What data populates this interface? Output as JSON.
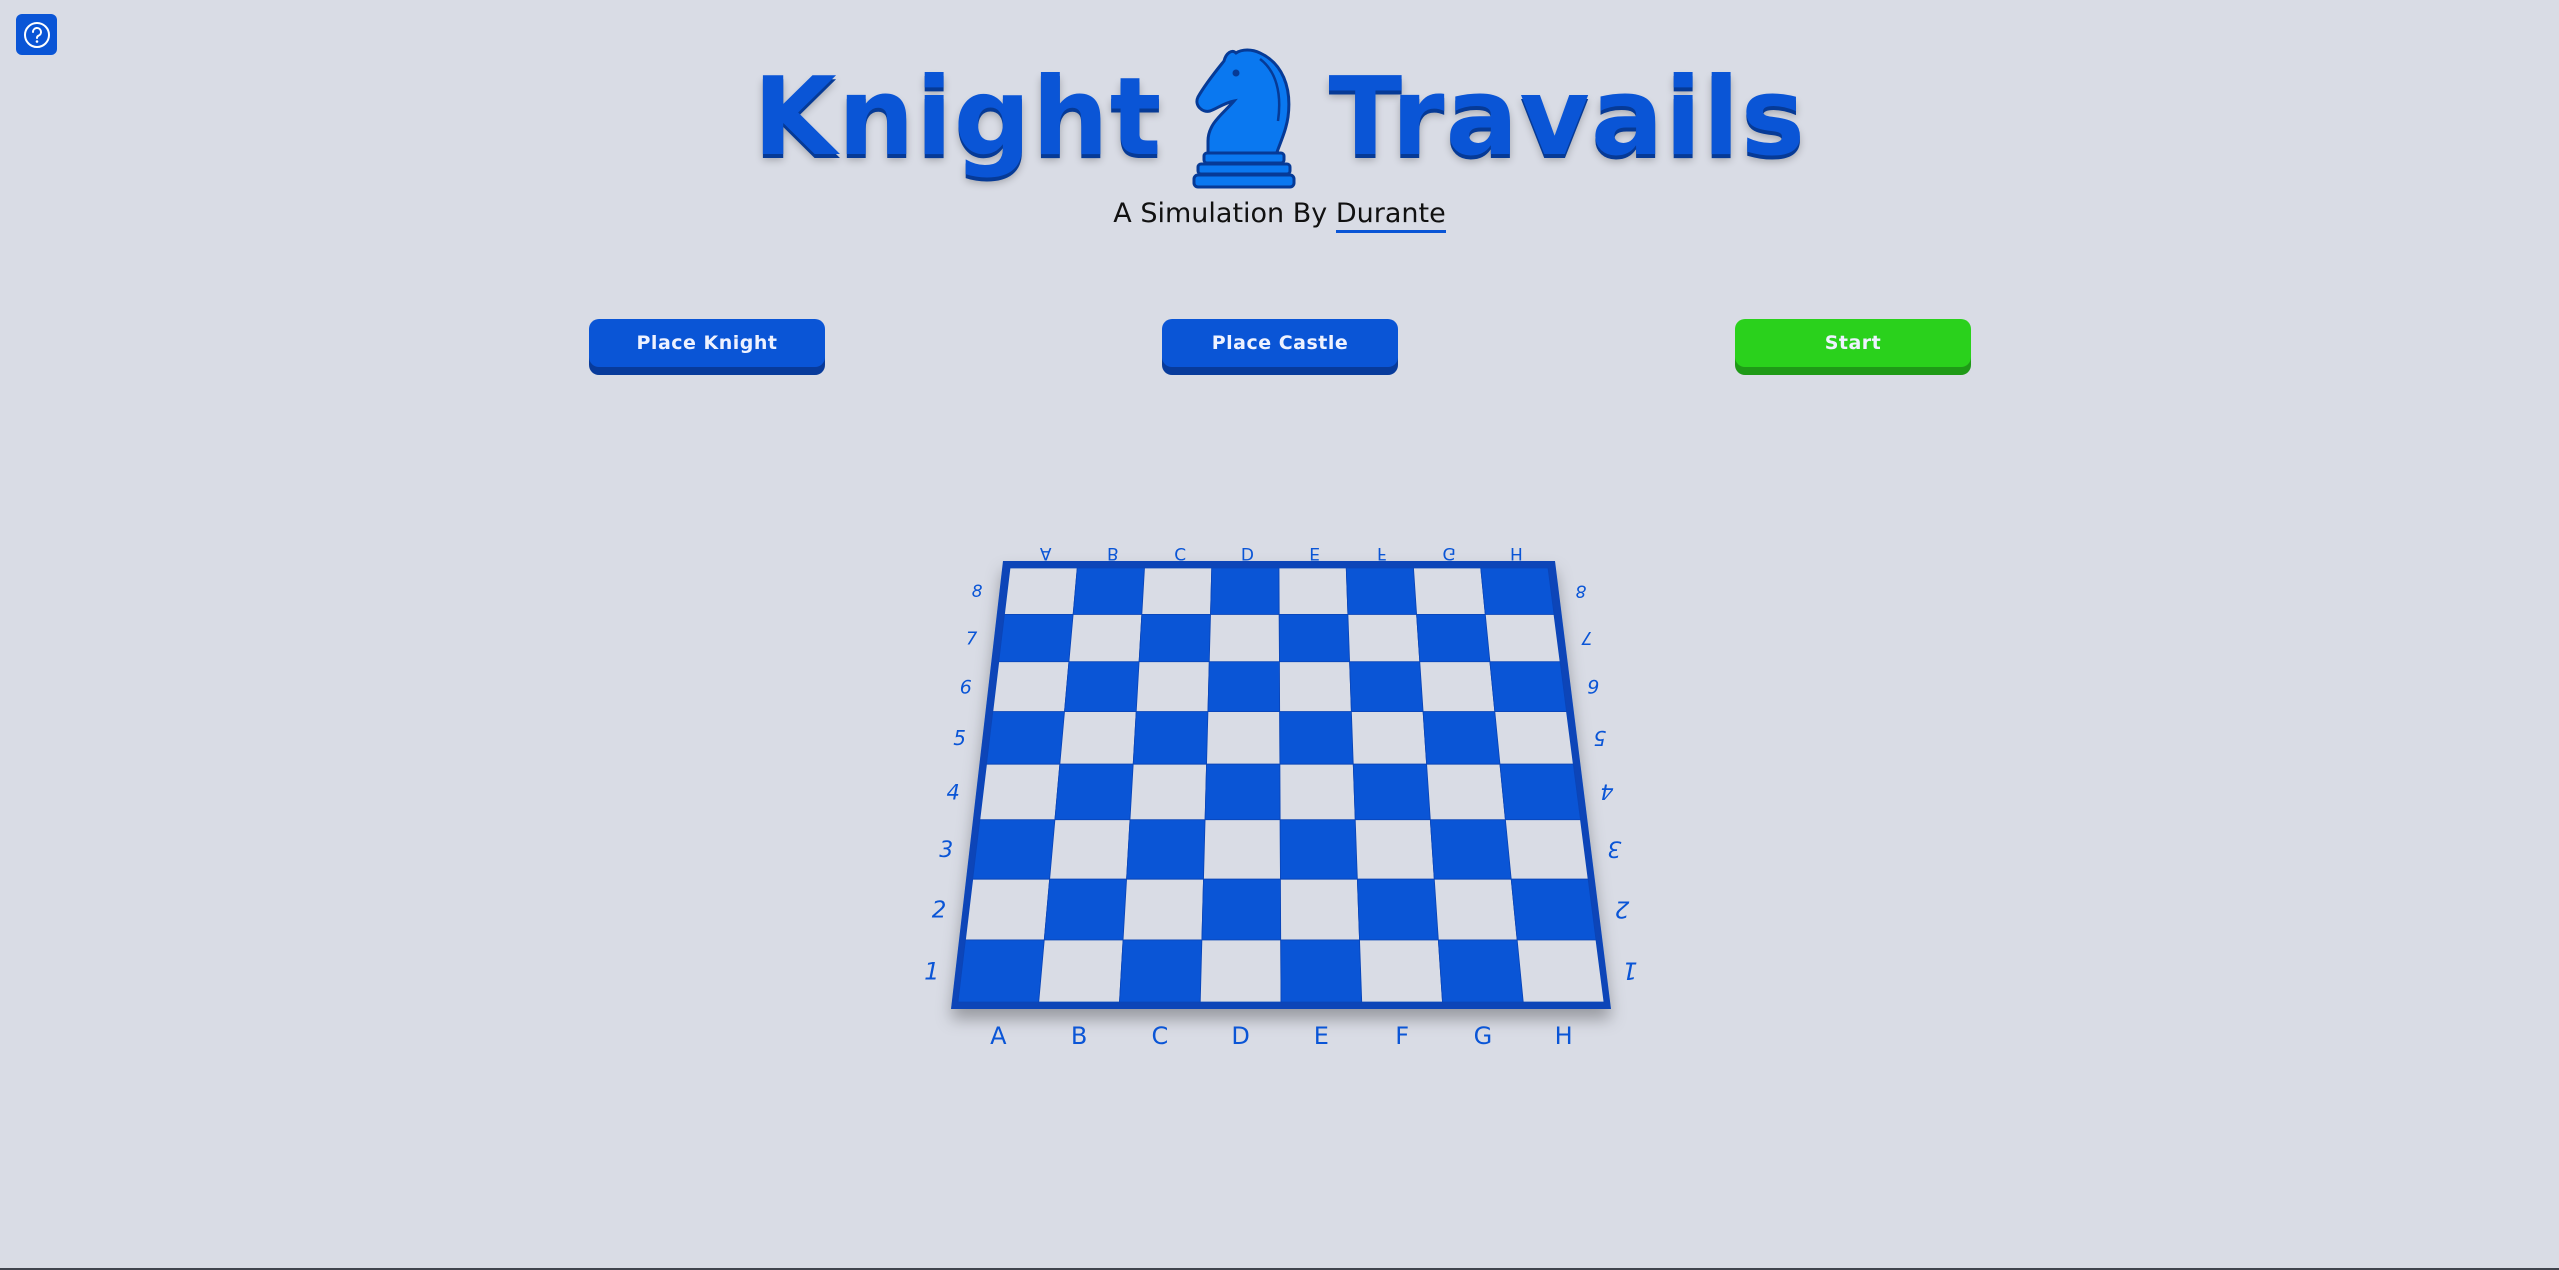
{
  "header": {
    "title_left": "Knight",
    "title_right": "Travails",
    "logo_icon": "knight-chess-piece-icon",
    "subtitle_prefix": "A Simulation By ",
    "author": "Durante"
  },
  "help": {
    "icon": "question-circle-icon"
  },
  "controls": {
    "place_knight": "Place Knight",
    "place_castle": "Place Castle",
    "start": "Start"
  },
  "board": {
    "files": [
      "A",
      "B",
      "C",
      "D",
      "E",
      "F",
      "G",
      "H"
    ],
    "ranks": [
      "1",
      "2",
      "3",
      "4",
      "5",
      "6",
      "7",
      "8"
    ],
    "orientation": "perspective, viewed from white side"
  },
  "colors": {
    "accent": "#0a55d6",
    "dark_square": "#0a55d6",
    "light_square": "#d9dce5",
    "start_button": "#2ad11c",
    "background": "#d9dce5"
  }
}
